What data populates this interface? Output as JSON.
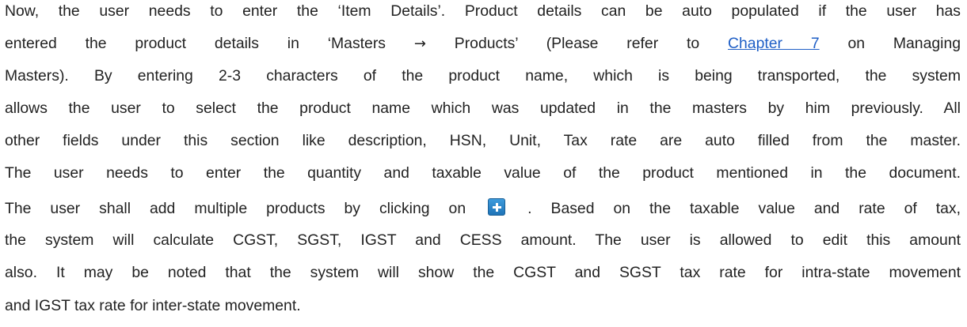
{
  "paragraph": {
    "line1": "Now, the user needs to enter the ‘Item Details’. Product details can be auto populated if the user has",
    "line2_a": "entered the product details in ‘Masters",
    "line2_arrow": "→",
    "line2_b": "Products’ (Please refer to",
    "line2_link": "Chapter 7",
    "line2_c": "on Managing",
    "line3": "Masters). By entering 2-3 characters of the product name, which is being transported, the system",
    "line4": "allows the user to select the product name which was updated in the masters by him previously. All",
    "line5": "other fields under this section like description, HSN, Unit, Tax rate are auto filled from the master.",
    "line6": "The user needs to enter the quantity and taxable value of the product mentioned in the document.",
    "line7_a": "The user shall add multiple products by clicking on",
    "line7_b": ". Based on the taxable value and rate of tax,",
    "line8": "the system will calculate CGST, SGST, IGST and CESS amount. The user is allowed to edit this amount",
    "line9": "also. It may be noted that the system will show the CGST and SGST tax rate for intra-state movement",
    "line10": "and IGST tax rate for inter-state movement."
  },
  "icons": {
    "add_button_icon": "plus-icon",
    "add_button_color": "#2a86c9"
  },
  "colors": {
    "text": "#222222",
    "link": "#1f5fc6"
  }
}
